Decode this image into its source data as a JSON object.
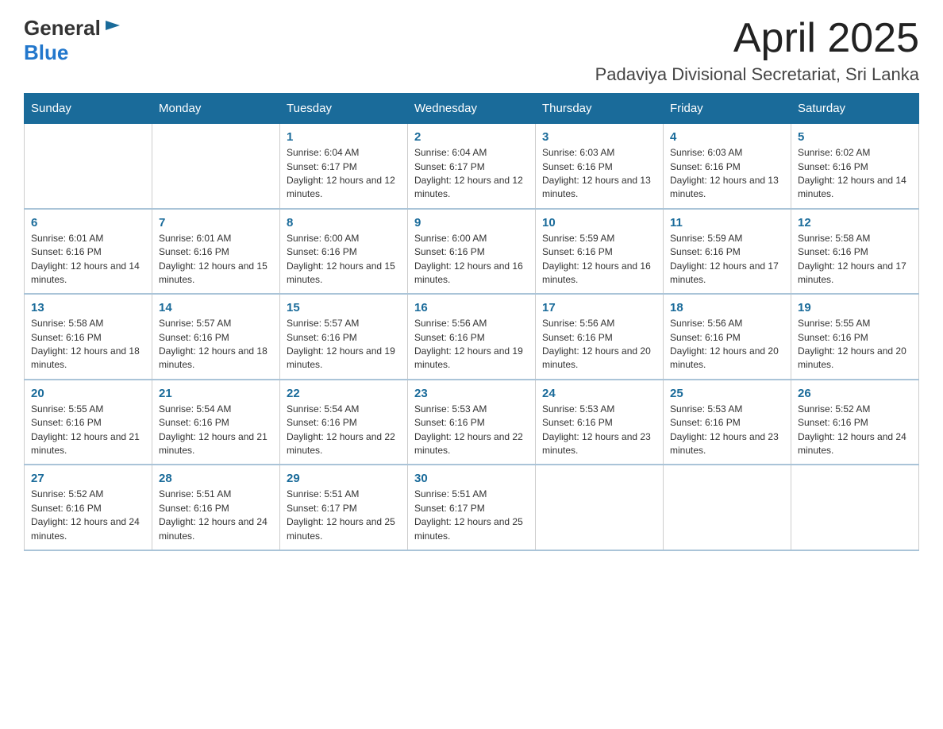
{
  "logo": {
    "text_general": "General",
    "text_blue": "Blue",
    "aria": "GeneralBlue logo"
  },
  "header": {
    "month_year": "April 2025",
    "location": "Padaviya Divisional Secretariat, Sri Lanka"
  },
  "weekdays": [
    "Sunday",
    "Monday",
    "Tuesday",
    "Wednesday",
    "Thursday",
    "Friday",
    "Saturday"
  ],
  "weeks": [
    [
      {
        "day": "",
        "sunrise": "",
        "sunset": "",
        "daylight": ""
      },
      {
        "day": "",
        "sunrise": "",
        "sunset": "",
        "daylight": ""
      },
      {
        "day": "1",
        "sunrise": "Sunrise: 6:04 AM",
        "sunset": "Sunset: 6:17 PM",
        "daylight": "Daylight: 12 hours and 12 minutes."
      },
      {
        "day": "2",
        "sunrise": "Sunrise: 6:04 AM",
        "sunset": "Sunset: 6:17 PM",
        "daylight": "Daylight: 12 hours and 12 minutes."
      },
      {
        "day": "3",
        "sunrise": "Sunrise: 6:03 AM",
        "sunset": "Sunset: 6:16 PM",
        "daylight": "Daylight: 12 hours and 13 minutes."
      },
      {
        "day": "4",
        "sunrise": "Sunrise: 6:03 AM",
        "sunset": "Sunset: 6:16 PM",
        "daylight": "Daylight: 12 hours and 13 minutes."
      },
      {
        "day": "5",
        "sunrise": "Sunrise: 6:02 AM",
        "sunset": "Sunset: 6:16 PM",
        "daylight": "Daylight: 12 hours and 14 minutes."
      }
    ],
    [
      {
        "day": "6",
        "sunrise": "Sunrise: 6:01 AM",
        "sunset": "Sunset: 6:16 PM",
        "daylight": "Daylight: 12 hours and 14 minutes."
      },
      {
        "day": "7",
        "sunrise": "Sunrise: 6:01 AM",
        "sunset": "Sunset: 6:16 PM",
        "daylight": "Daylight: 12 hours and 15 minutes."
      },
      {
        "day": "8",
        "sunrise": "Sunrise: 6:00 AM",
        "sunset": "Sunset: 6:16 PM",
        "daylight": "Daylight: 12 hours and 15 minutes."
      },
      {
        "day": "9",
        "sunrise": "Sunrise: 6:00 AM",
        "sunset": "Sunset: 6:16 PM",
        "daylight": "Daylight: 12 hours and 16 minutes."
      },
      {
        "day": "10",
        "sunrise": "Sunrise: 5:59 AM",
        "sunset": "Sunset: 6:16 PM",
        "daylight": "Daylight: 12 hours and 16 minutes."
      },
      {
        "day": "11",
        "sunrise": "Sunrise: 5:59 AM",
        "sunset": "Sunset: 6:16 PM",
        "daylight": "Daylight: 12 hours and 17 minutes."
      },
      {
        "day": "12",
        "sunrise": "Sunrise: 5:58 AM",
        "sunset": "Sunset: 6:16 PM",
        "daylight": "Daylight: 12 hours and 17 minutes."
      }
    ],
    [
      {
        "day": "13",
        "sunrise": "Sunrise: 5:58 AM",
        "sunset": "Sunset: 6:16 PM",
        "daylight": "Daylight: 12 hours and 18 minutes."
      },
      {
        "day": "14",
        "sunrise": "Sunrise: 5:57 AM",
        "sunset": "Sunset: 6:16 PM",
        "daylight": "Daylight: 12 hours and 18 minutes."
      },
      {
        "day": "15",
        "sunrise": "Sunrise: 5:57 AM",
        "sunset": "Sunset: 6:16 PM",
        "daylight": "Daylight: 12 hours and 19 minutes."
      },
      {
        "day": "16",
        "sunrise": "Sunrise: 5:56 AM",
        "sunset": "Sunset: 6:16 PM",
        "daylight": "Daylight: 12 hours and 19 minutes."
      },
      {
        "day": "17",
        "sunrise": "Sunrise: 5:56 AM",
        "sunset": "Sunset: 6:16 PM",
        "daylight": "Daylight: 12 hours and 20 minutes."
      },
      {
        "day": "18",
        "sunrise": "Sunrise: 5:56 AM",
        "sunset": "Sunset: 6:16 PM",
        "daylight": "Daylight: 12 hours and 20 minutes."
      },
      {
        "day": "19",
        "sunrise": "Sunrise: 5:55 AM",
        "sunset": "Sunset: 6:16 PM",
        "daylight": "Daylight: 12 hours and 20 minutes."
      }
    ],
    [
      {
        "day": "20",
        "sunrise": "Sunrise: 5:55 AM",
        "sunset": "Sunset: 6:16 PM",
        "daylight": "Daylight: 12 hours and 21 minutes."
      },
      {
        "day": "21",
        "sunrise": "Sunrise: 5:54 AM",
        "sunset": "Sunset: 6:16 PM",
        "daylight": "Daylight: 12 hours and 21 minutes."
      },
      {
        "day": "22",
        "sunrise": "Sunrise: 5:54 AM",
        "sunset": "Sunset: 6:16 PM",
        "daylight": "Daylight: 12 hours and 22 minutes."
      },
      {
        "day": "23",
        "sunrise": "Sunrise: 5:53 AM",
        "sunset": "Sunset: 6:16 PM",
        "daylight": "Daylight: 12 hours and 22 minutes."
      },
      {
        "day": "24",
        "sunrise": "Sunrise: 5:53 AM",
        "sunset": "Sunset: 6:16 PM",
        "daylight": "Daylight: 12 hours and 23 minutes."
      },
      {
        "day": "25",
        "sunrise": "Sunrise: 5:53 AM",
        "sunset": "Sunset: 6:16 PM",
        "daylight": "Daylight: 12 hours and 23 minutes."
      },
      {
        "day": "26",
        "sunrise": "Sunrise: 5:52 AM",
        "sunset": "Sunset: 6:16 PM",
        "daylight": "Daylight: 12 hours and 24 minutes."
      }
    ],
    [
      {
        "day": "27",
        "sunrise": "Sunrise: 5:52 AM",
        "sunset": "Sunset: 6:16 PM",
        "daylight": "Daylight: 12 hours and 24 minutes."
      },
      {
        "day": "28",
        "sunrise": "Sunrise: 5:51 AM",
        "sunset": "Sunset: 6:16 PM",
        "daylight": "Daylight: 12 hours and 24 minutes."
      },
      {
        "day": "29",
        "sunrise": "Sunrise: 5:51 AM",
        "sunset": "Sunset: 6:17 PM",
        "daylight": "Daylight: 12 hours and 25 minutes."
      },
      {
        "day": "30",
        "sunrise": "Sunrise: 5:51 AM",
        "sunset": "Sunset: 6:17 PM",
        "daylight": "Daylight: 12 hours and 25 minutes."
      },
      {
        "day": "",
        "sunrise": "",
        "sunset": "",
        "daylight": ""
      },
      {
        "day": "",
        "sunrise": "",
        "sunset": "",
        "daylight": ""
      },
      {
        "day": "",
        "sunrise": "",
        "sunset": "",
        "daylight": ""
      }
    ]
  ]
}
